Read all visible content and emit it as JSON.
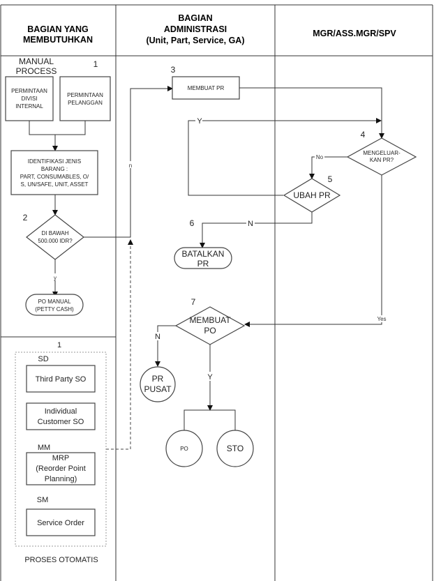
{
  "lanes": {
    "left": [
      "BAGIAN YANG",
      "MEMBUTUHKAN"
    ],
    "middle": [
      "BAGIAN",
      "ADMINISTRASI",
      "(Unit, Part, Service, GA)"
    ],
    "right": [
      "MGR/ASS.MGR/SPV"
    ]
  },
  "manual": {
    "title": [
      "MANUAL",
      "PROCESS"
    ],
    "step": "1",
    "divisi": [
      "PERMINTAAN",
      "DIVISI",
      "INTERNAL"
    ],
    "pelanggan": [
      "PERMINTAAN",
      "PELANGGAN"
    ],
    "identifikasi": [
      "IDENTIFIKASI JENIS",
      "BARANG :",
      "PART, CONSUMABLES, O/",
      "S, UN/SAFE, UNIT, ASSET"
    ],
    "step2": "2",
    "dibawah": [
      "DI BAWAH",
      "500.000 IDR?"
    ],
    "y_label": "y",
    "n_label": "n",
    "pomanual": [
      "PO MANUAL",
      "(PETTY CASH)"
    ]
  },
  "admin": {
    "step3": "3",
    "membuat_pr": "MEMBUAT PR",
    "y_label": "Y",
    "step5": "5",
    "ubah_pr": "UBAH PR",
    "n_label": "N",
    "step6": "6",
    "batalkan": [
      "BATALKAN",
      "PR"
    ],
    "step7": "7",
    "membuat_po": [
      "MEMBUAT",
      "PO"
    ],
    "po_n": "N",
    "po_y": "Y",
    "pr_pusat": [
      "PR",
      "PUSAT"
    ],
    "po": "PO",
    "sto": "STO"
  },
  "mgr": {
    "step4": "4",
    "mengeluarkan": [
      "MENGELUAR-",
      "KAN PR?"
    ],
    "no_label": "No",
    "yes_label": "Yes"
  },
  "auto": {
    "step": "1",
    "sd": "SD",
    "third_party": "Third Party SO",
    "individual": [
      "Individual",
      "Customer SO"
    ],
    "mm": "MM",
    "mrp": [
      "MRP",
      "(Reorder Point",
      "Planning)"
    ],
    "sm": "SM",
    "service_order": "Service Order",
    "title": "PROSES OTOMATIS"
  }
}
